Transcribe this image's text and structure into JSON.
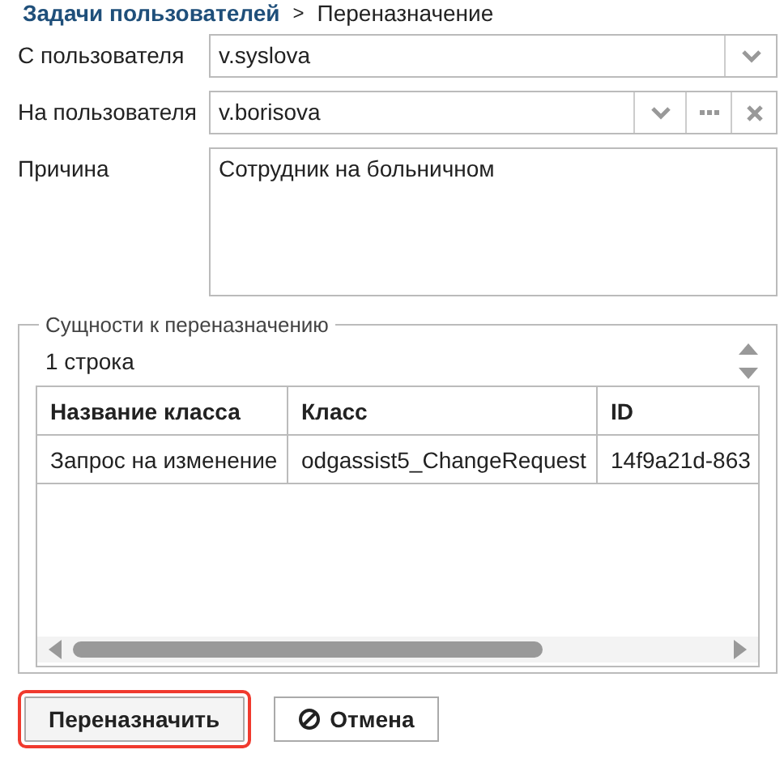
{
  "breadcrumb": {
    "parent": "Задачи пользователей",
    "separator": ">",
    "current": "Переназначение"
  },
  "fields": [
    {
      "kind": "select",
      "label": "С пользователя",
      "value": "v.syslova"
    },
    {
      "kind": "lookup",
      "label": "На пользователя",
      "value": "v.borisova"
    },
    {
      "kind": "textarea",
      "label": "Причина",
      "value": "Сотрудник на больничном"
    }
  ],
  "entities": {
    "legend": "Сущности к переназначению",
    "count": "1 строка",
    "table": {
      "columns": [
        "Название класса",
        "Класс",
        "ID"
      ],
      "rows": [
        [
          "Запрос на изменение",
          "odgassist5_ChangeRequest",
          "14f9a21d-863"
        ]
      ]
    }
  },
  "buttons": [
    {
      "kind": "primary",
      "label": "Переназначить",
      "highlighted": true
    },
    {
      "kind": "cancel",
      "label": "Отмена",
      "highlighted": false
    }
  ]
}
